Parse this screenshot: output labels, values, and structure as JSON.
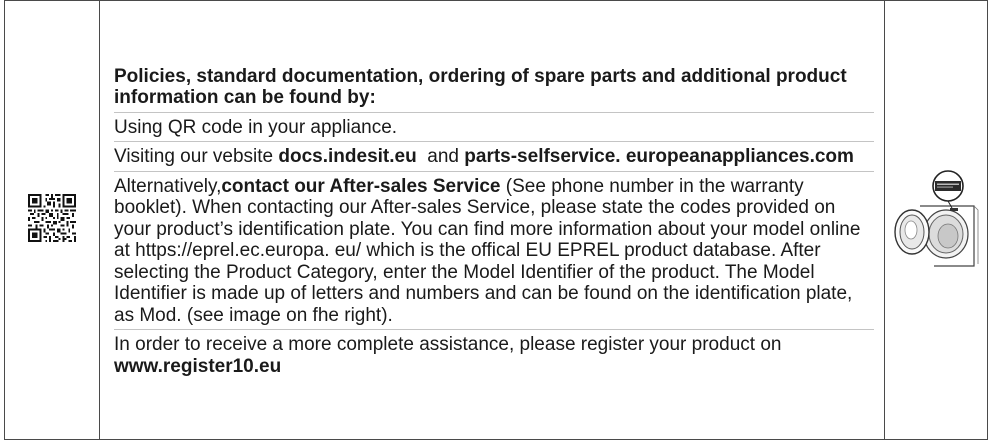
{
  "heading": "Policies, standard documentation, ordering of spare parts and additional product information can be found by:",
  "qr_line": "Using QR code in your appliance.",
  "website_line": {
    "prefix": "Visiting our vebsite ",
    "site1": "docs.indesit.eu",
    "middle": "  and ",
    "site2": "parts-selfservice. europeanappliances.com"
  },
  "contact_paragraph": {
    "prefix": "Alternatively,",
    "link": "contact our After-sales Service",
    "body": " (See phone number in the warranty booklet). When contacting our After-sales Service, please state the codes provided on your product’s identification plate. You can find more information about your model online at https://eprel.ec.europa. eu/ which is the offical EU EPREL product database. After selecting  the Product Category, enter the Model Identifier  of the product. The Model Identifier is made up of letters and numbers and can be found on the identification plate, as Mod. (see image on fhe right)."
  },
  "register_paragraph": {
    "text": "In order to receive a more complete assistance, please register your product on ",
    "link": "www.register10.eu"
  },
  "icons": {
    "qr": "qr-code-icon",
    "appliance": "washing-machine-identification-plate-icon"
  },
  "colors": {
    "text": "#1a1a1a",
    "border": "#4a4a4a",
    "divider": "#c4c4c4"
  }
}
